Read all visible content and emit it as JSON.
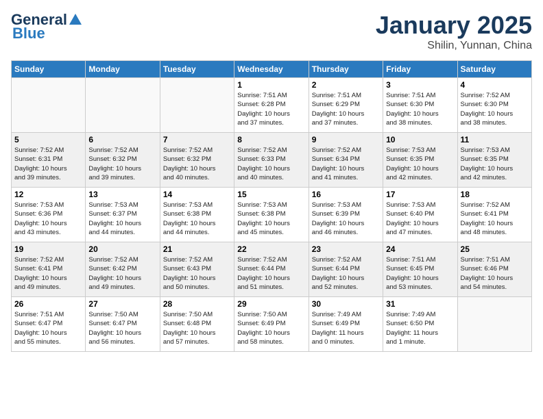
{
  "header": {
    "logo_general": "General",
    "logo_blue": "Blue",
    "month_title": "January 2025",
    "subtitle": "Shilin, Yunnan, China"
  },
  "days_of_week": [
    "Sunday",
    "Monday",
    "Tuesday",
    "Wednesday",
    "Thursday",
    "Friday",
    "Saturday"
  ],
  "weeks": [
    [
      {
        "day": "",
        "info": ""
      },
      {
        "day": "",
        "info": ""
      },
      {
        "day": "",
        "info": ""
      },
      {
        "day": "1",
        "info": "Sunrise: 7:51 AM\nSunset: 6:28 PM\nDaylight: 10 hours\nand 37 minutes."
      },
      {
        "day": "2",
        "info": "Sunrise: 7:51 AM\nSunset: 6:29 PM\nDaylight: 10 hours\nand 37 minutes."
      },
      {
        "day": "3",
        "info": "Sunrise: 7:51 AM\nSunset: 6:30 PM\nDaylight: 10 hours\nand 38 minutes."
      },
      {
        "day": "4",
        "info": "Sunrise: 7:52 AM\nSunset: 6:30 PM\nDaylight: 10 hours\nand 38 minutes."
      }
    ],
    [
      {
        "day": "5",
        "info": "Sunrise: 7:52 AM\nSunset: 6:31 PM\nDaylight: 10 hours\nand 39 minutes."
      },
      {
        "day": "6",
        "info": "Sunrise: 7:52 AM\nSunset: 6:32 PM\nDaylight: 10 hours\nand 39 minutes."
      },
      {
        "day": "7",
        "info": "Sunrise: 7:52 AM\nSunset: 6:32 PM\nDaylight: 10 hours\nand 40 minutes."
      },
      {
        "day": "8",
        "info": "Sunrise: 7:52 AM\nSunset: 6:33 PM\nDaylight: 10 hours\nand 40 minutes."
      },
      {
        "day": "9",
        "info": "Sunrise: 7:52 AM\nSunset: 6:34 PM\nDaylight: 10 hours\nand 41 minutes."
      },
      {
        "day": "10",
        "info": "Sunrise: 7:53 AM\nSunset: 6:35 PM\nDaylight: 10 hours\nand 42 minutes."
      },
      {
        "day": "11",
        "info": "Sunrise: 7:53 AM\nSunset: 6:35 PM\nDaylight: 10 hours\nand 42 minutes."
      }
    ],
    [
      {
        "day": "12",
        "info": "Sunrise: 7:53 AM\nSunset: 6:36 PM\nDaylight: 10 hours\nand 43 minutes."
      },
      {
        "day": "13",
        "info": "Sunrise: 7:53 AM\nSunset: 6:37 PM\nDaylight: 10 hours\nand 44 minutes."
      },
      {
        "day": "14",
        "info": "Sunrise: 7:53 AM\nSunset: 6:38 PM\nDaylight: 10 hours\nand 44 minutes."
      },
      {
        "day": "15",
        "info": "Sunrise: 7:53 AM\nSunset: 6:38 PM\nDaylight: 10 hours\nand 45 minutes."
      },
      {
        "day": "16",
        "info": "Sunrise: 7:53 AM\nSunset: 6:39 PM\nDaylight: 10 hours\nand 46 minutes."
      },
      {
        "day": "17",
        "info": "Sunrise: 7:53 AM\nSunset: 6:40 PM\nDaylight: 10 hours\nand 47 minutes."
      },
      {
        "day": "18",
        "info": "Sunrise: 7:52 AM\nSunset: 6:41 PM\nDaylight: 10 hours\nand 48 minutes."
      }
    ],
    [
      {
        "day": "19",
        "info": "Sunrise: 7:52 AM\nSunset: 6:41 PM\nDaylight: 10 hours\nand 49 minutes."
      },
      {
        "day": "20",
        "info": "Sunrise: 7:52 AM\nSunset: 6:42 PM\nDaylight: 10 hours\nand 49 minutes."
      },
      {
        "day": "21",
        "info": "Sunrise: 7:52 AM\nSunset: 6:43 PM\nDaylight: 10 hours\nand 50 minutes."
      },
      {
        "day": "22",
        "info": "Sunrise: 7:52 AM\nSunset: 6:44 PM\nDaylight: 10 hours\nand 51 minutes."
      },
      {
        "day": "23",
        "info": "Sunrise: 7:52 AM\nSunset: 6:44 PM\nDaylight: 10 hours\nand 52 minutes."
      },
      {
        "day": "24",
        "info": "Sunrise: 7:51 AM\nSunset: 6:45 PM\nDaylight: 10 hours\nand 53 minutes."
      },
      {
        "day": "25",
        "info": "Sunrise: 7:51 AM\nSunset: 6:46 PM\nDaylight: 10 hours\nand 54 minutes."
      }
    ],
    [
      {
        "day": "26",
        "info": "Sunrise: 7:51 AM\nSunset: 6:47 PM\nDaylight: 10 hours\nand 55 minutes."
      },
      {
        "day": "27",
        "info": "Sunrise: 7:50 AM\nSunset: 6:47 PM\nDaylight: 10 hours\nand 56 minutes."
      },
      {
        "day": "28",
        "info": "Sunrise: 7:50 AM\nSunset: 6:48 PM\nDaylight: 10 hours\nand 57 minutes."
      },
      {
        "day": "29",
        "info": "Sunrise: 7:50 AM\nSunset: 6:49 PM\nDaylight: 10 hours\nand 58 minutes."
      },
      {
        "day": "30",
        "info": "Sunrise: 7:49 AM\nSunset: 6:49 PM\nDaylight: 11 hours\nand 0 minutes."
      },
      {
        "day": "31",
        "info": "Sunrise: 7:49 AM\nSunset: 6:50 PM\nDaylight: 11 hours\nand 1 minute."
      },
      {
        "day": "",
        "info": ""
      }
    ]
  ]
}
